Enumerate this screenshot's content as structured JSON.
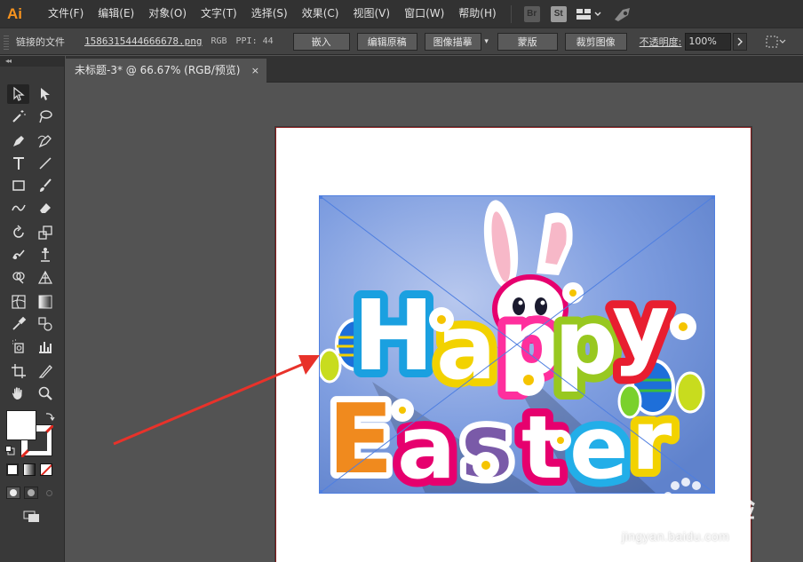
{
  "app": {
    "logo": "Ai"
  },
  "menu": {
    "items": [
      "文件(F)",
      "编辑(E)",
      "对象(O)",
      "文字(T)",
      "选择(S)",
      "效果(C)",
      "视图(V)",
      "窗口(W)",
      "帮助(H)"
    ]
  },
  "menubar_badges": {
    "bridge": "Br",
    "stock": "St"
  },
  "control_bar": {
    "linked_file_label": "链接的文件",
    "filename": "1586315444666678.png",
    "color_mode": "RGB",
    "ppi": "PPI: 44",
    "embed": "嵌入",
    "edit_original": "编辑原稿",
    "image_trace": "图像描摹",
    "mask": "蒙版",
    "crop_image": "裁剪图像",
    "opacity_label": "不透明度:",
    "opacity_value": "100%"
  },
  "document": {
    "tab_title": "未标题-3* @ 66.67% (RGB/预览)",
    "close_glyph": "×"
  },
  "artwork": {
    "word_happy": [
      "H",
      "a",
      "p",
      "p",
      "y"
    ],
    "word_easter": [
      "E",
      "a",
      "s",
      "t",
      "e",
      "r"
    ]
  },
  "watermark": {
    "brand": "Bai du 经验",
    "domain": "jingyan.baidu.com"
  },
  "icons": {
    "selection": "selection-arrow-icon",
    "direct": "direct-selection-icon",
    "magic": "magic-wand-icon",
    "lasso": "lasso-icon",
    "pen": "pen-icon",
    "curvature": "curvature-icon",
    "type": "type-icon",
    "line": "line-segment-icon",
    "rect": "rectangle-icon",
    "brush": "paintbrush-icon",
    "shaper": "shaper-icon",
    "eraser": "eraser-icon",
    "rotate": "rotate-icon",
    "scale": "scale-icon",
    "warp": "warp-icon",
    "puppet": "puppet-warp-icon",
    "shape_builder": "shape-builder-icon",
    "perspective": "perspective-grid-icon",
    "mesh": "mesh-icon",
    "gradient": "gradient-icon",
    "eyedropper": "eyedropper-icon",
    "blend": "blend-icon",
    "symbol": "symbol-sprayer-icon",
    "graph": "graph-icon",
    "artboard": "artboard-icon",
    "slice": "slice-icon",
    "hand": "hand-icon",
    "zoom": "zoom-icon"
  }
}
